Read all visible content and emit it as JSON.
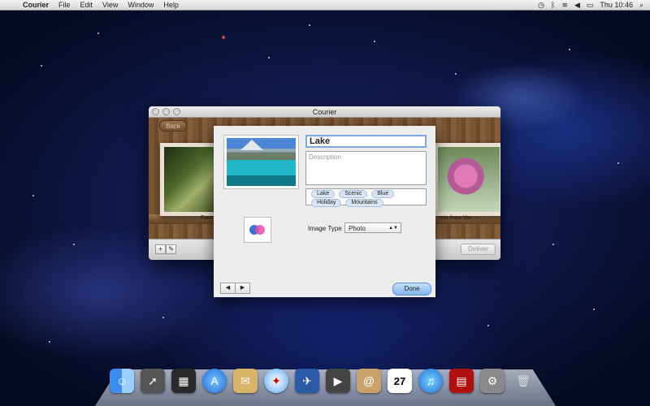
{
  "menubar": {
    "app_name": "Courier",
    "items": [
      "File",
      "Edit",
      "View",
      "Window",
      "Help"
    ],
    "clock": "Thu 10:46"
  },
  "window": {
    "title": "Courier",
    "back_label": "Back",
    "caption_left": "Fore",
    "caption_right": "mix from Van...",
    "deliver_label": "Deliver",
    "add_label": "+"
  },
  "sheet": {
    "name_value": "Lake",
    "description_placeholder": "Description",
    "tags": [
      "Lake",
      "Scenic",
      "Blue",
      "Holiday",
      "Mountains"
    ],
    "image_type_label": "Image Type",
    "image_type_value": "Photo",
    "done_label": "Done"
  },
  "dock": {
    "icons": [
      "finder-icon",
      "launchpad-icon",
      "photo-booth-icon",
      "app-store-icon",
      "mail-icon",
      "safari-icon",
      "courier-icon",
      "facetime-icon",
      "address-book-icon",
      "ical-icon",
      "itunes-icon",
      "photo-booth-2-icon",
      "system-preferences-icon",
      "trash-icon"
    ],
    "calendar_day": "27"
  }
}
